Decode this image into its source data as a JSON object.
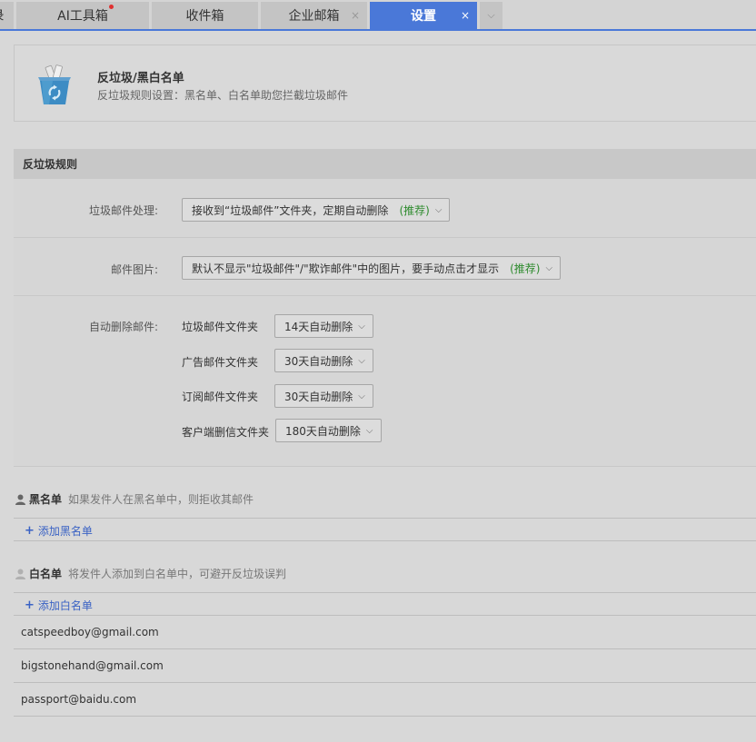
{
  "tabs": [
    {
      "label": "录"
    },
    {
      "label": "AI工具箱",
      "has_dot": true
    },
    {
      "label": "收件箱"
    },
    {
      "label": "企业邮箱",
      "closable": true
    },
    {
      "label": "设置",
      "closable": true,
      "active": true
    }
  ],
  "tab_close_glyph": "×",
  "tab_more_glyph": "⌵",
  "header": {
    "title": "反垃圾/黑白名单",
    "description": "反垃圾规则设置：黑名单、白名单助您拦截垃圾邮件"
  },
  "rules": {
    "section_title": "反垃圾规则",
    "spam_handling": {
      "label": "垃圾邮件处理:",
      "value": "接收到“垃圾邮件”文件夹，定期自动删除",
      "recommend": "(推荐)"
    },
    "mail_images": {
      "label": "邮件图片:",
      "value": "默认不显示\"垃圾邮件\"/\"欺诈邮件\"中的图片，要手动点击才显示",
      "recommend": "(推荐)"
    },
    "auto_delete": {
      "label": "自动删除邮件:",
      "folders": [
        {
          "name": "垃圾邮件文件夹",
          "value": "14天自动删除"
        },
        {
          "name": "广告邮件文件夹",
          "value": "30天自动删除"
        },
        {
          "name": "订阅邮件文件夹",
          "value": "30天自动删除"
        },
        {
          "name": "客户端删信文件夹",
          "value": "180天自动删除"
        }
      ]
    },
    "chevron": "⌵"
  },
  "blacklist": {
    "title": "黑名单",
    "hint": "如果发件人在黑名单中，则拒收其邮件",
    "add_label": "添加黑名单",
    "icon_color": "#666666"
  },
  "whitelist": {
    "title": "白名单",
    "hint": "将发件人添加到白名单中，可避开反垃圾误判",
    "add_label": "添加白名单",
    "icon_color": "#b0b0b0",
    "emails": [
      "catspeedboy@gmail.com",
      "bigstonehand@gmail.com",
      "passport@baidu.com"
    ]
  },
  "add_glyph": "+",
  "colors": {
    "accent": "#4a78d8",
    "link": "#3a62c4",
    "recommend": "#2e8b2e"
  }
}
